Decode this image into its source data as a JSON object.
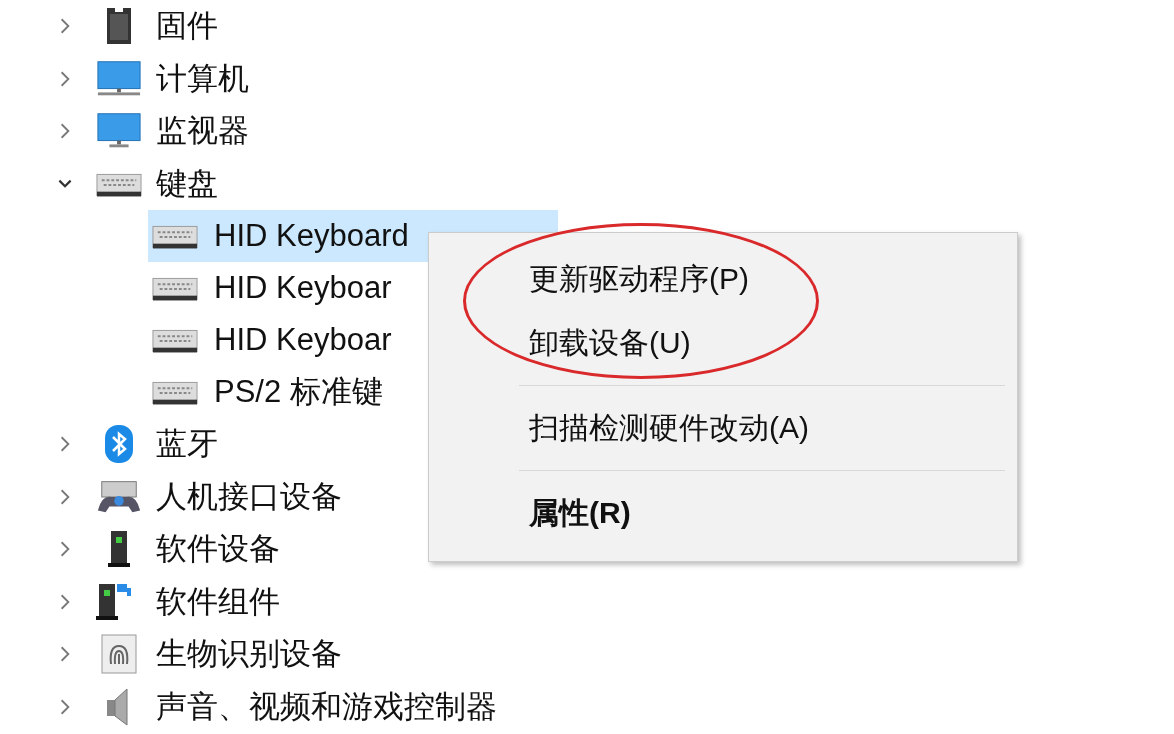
{
  "tree": [
    {
      "label": "固件",
      "kind": "firmware",
      "expanded": false
    },
    {
      "label": "计算机",
      "kind": "computer",
      "expanded": false
    },
    {
      "label": "监视器",
      "kind": "monitor",
      "expanded": false
    },
    {
      "label": "键盘",
      "kind": "keyboard",
      "expanded": true,
      "children": [
        {
          "label": "HID Keyboard",
          "kind": "keyboard",
          "selected": true
        },
        {
          "label": "HID Keyboar",
          "kind": "keyboard",
          "selected": false
        },
        {
          "label": "HID Keyboar",
          "kind": "keyboard",
          "selected": false
        },
        {
          "label": "PS/2 标准键",
          "kind": "keyboard",
          "selected": false
        }
      ]
    },
    {
      "label": "蓝牙",
      "kind": "bluetooth",
      "expanded": false
    },
    {
      "label": "人机接口设备",
      "kind": "hid",
      "expanded": false
    },
    {
      "label": "软件设备",
      "kind": "software-device",
      "expanded": false
    },
    {
      "label": "软件组件",
      "kind": "software-component",
      "expanded": false
    },
    {
      "label": "生物识别设备",
      "kind": "biometric",
      "expanded": false
    },
    {
      "label": "声音、视频和游戏控制器",
      "kind": "audio",
      "expanded": false
    }
  ],
  "context_menu": {
    "items": [
      {
        "label": "更新驱动程序(P)",
        "kind": "item",
        "bold": false,
        "circled": true
      },
      {
        "label": "卸载设备(U)",
        "kind": "item",
        "bold": false,
        "circled": true
      },
      {
        "kind": "separator"
      },
      {
        "label": "扫描检测硬件改动(A)",
        "kind": "item",
        "bold": false,
        "circled": false
      },
      {
        "kind": "separator"
      },
      {
        "label": "属性(R)",
        "kind": "item",
        "bold": true,
        "circled": false
      }
    ]
  }
}
